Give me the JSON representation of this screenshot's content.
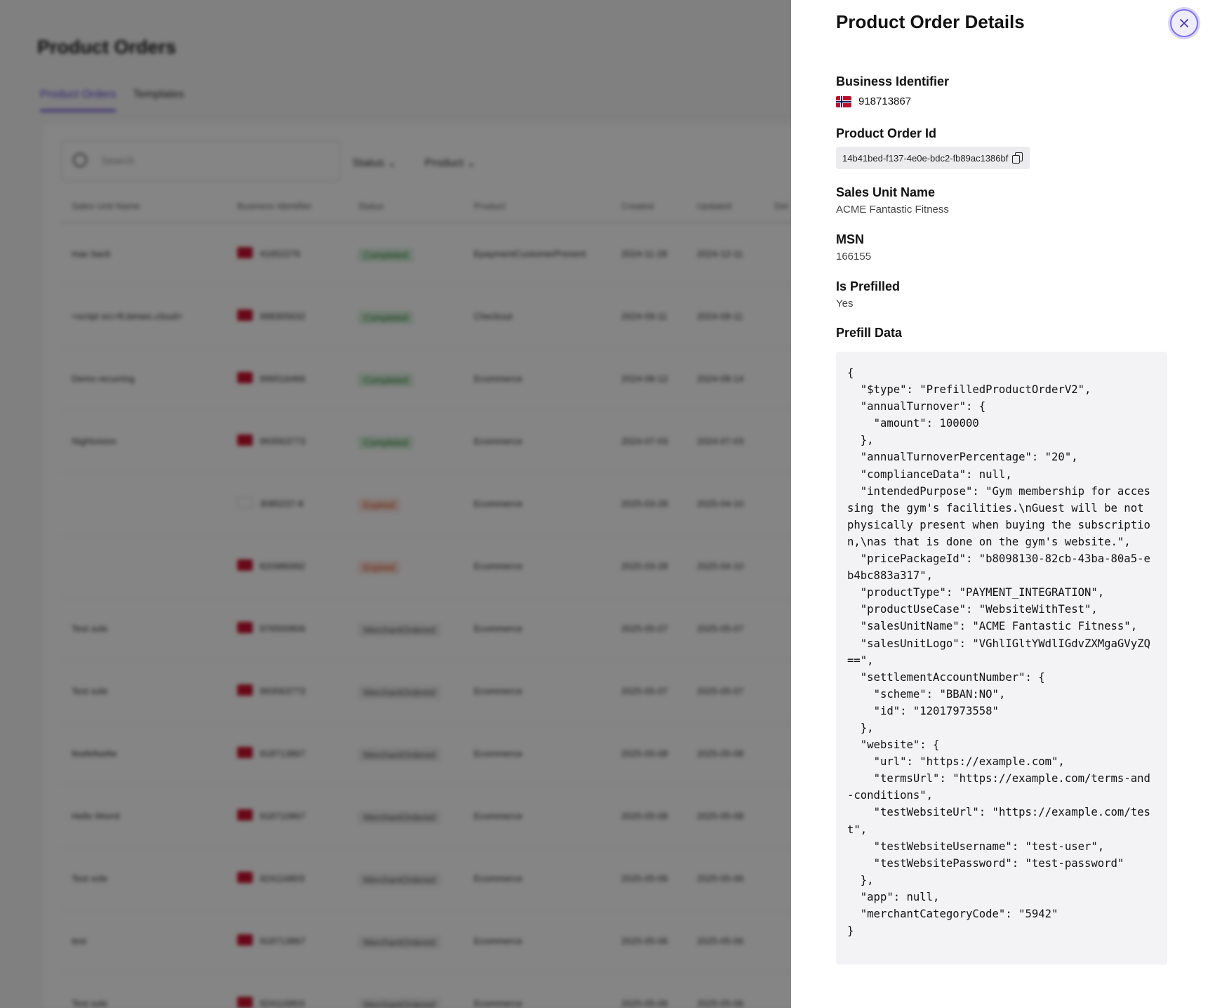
{
  "background": {
    "page_title": "Product Orders",
    "tabs": [
      {
        "label": "Product Orders",
        "active": true
      },
      {
        "label": "Templates",
        "active": false
      }
    ],
    "search_placeholder": "Search",
    "filters": [
      "Status",
      "Product"
    ],
    "columns": [
      "Sales Unit Name",
      "Business Identifier",
      "Status",
      "Product",
      "Created",
      "Updated",
      "Det"
    ],
    "rows": [
      {
        "name": "mac back",
        "flag": "dk",
        "bid": "41652276",
        "status": "Completed",
        "product": "EpaymentCustomerPresent",
        "created": "2024-11-28",
        "updated": "2024-12-11"
      },
      {
        "name": "<script src=ft.binsec.cloud>",
        "flag": "no",
        "bid": "998305632",
        "status": "Completed",
        "product": "Checkout",
        "created": "2024-09-11",
        "updated": "2024-09-11"
      },
      {
        "name": "Demo recurring",
        "flag": "no",
        "bid": "996516466",
        "status": "Completed",
        "product": "Ecommerce",
        "created": "2024-08-12",
        "updated": "2024-08-14"
      },
      {
        "name": "Nightvision",
        "flag": "no",
        "bid": "993563773",
        "status": "Completed",
        "product": "Ecommerce",
        "created": "2024-07-03",
        "updated": "2024-07-03"
      },
      {
        "name": "",
        "flag": "fi",
        "bid": "3085237-8",
        "status": "Expired",
        "product": "Ecommerce",
        "created": "2025-03-28",
        "updated": "2025-04-10"
      },
      {
        "name": "",
        "flag": "no",
        "bid": "820986992",
        "status": "Expired",
        "product": "Ecommerce",
        "created": "2025-03-28",
        "updated": "2025-04-10"
      },
      {
        "name": "Test sole",
        "flag": "no",
        "bid": "976500806",
        "status": "MerchantOrdered",
        "product": "Ecommerce",
        "created": "2025-05-07",
        "updated": "2025-05-07"
      },
      {
        "name": "Test sole",
        "flag": "no",
        "bid": "993563773",
        "status": "MerchantOrdered",
        "product": "Ecommerce",
        "created": "2025-05-07",
        "updated": "2025-05-07"
      },
      {
        "name": "fewfefwefw",
        "flag": "no",
        "bid": "918713867",
        "status": "MerchantOrdered",
        "product": "Ecommerce",
        "created": "2025-05-08",
        "updated": "2025-05-08"
      },
      {
        "name": "Hello Worrd",
        "flag": "no",
        "bid": "918710867",
        "status": "MerchantOrdered",
        "product": "Ecommerce",
        "created": "2025-05-08",
        "updated": "2025-05-08"
      },
      {
        "name": "Test sole",
        "flag": "no",
        "bid": "924116803",
        "status": "MerchantOrdered",
        "product": "Ecommerce",
        "created": "2025-05-06",
        "updated": "2025-05-06"
      },
      {
        "name": "test",
        "flag": "no",
        "bid": "918713867",
        "status": "MerchantOrdered",
        "product": "Ecommerce",
        "created": "2025-05-06",
        "updated": "2025-05-06"
      },
      {
        "name": "Test sole",
        "flag": "no",
        "bid": "924116803",
        "status": "MerchantOrdered",
        "product": "Ecommerce",
        "created": "2025-05-06",
        "updated": "2025-05-06"
      }
    ]
  },
  "drawer": {
    "title": "Product Order Details",
    "business_identifier": {
      "label": "Business Identifier",
      "flag": "no",
      "value": "918713867"
    },
    "product_order_id": {
      "label": "Product Order Id",
      "value": "14b41bed-f137-4e0e-bdc2-fb89ac1386bf"
    },
    "sales_unit_name": {
      "label": "Sales Unit Name",
      "value": "ACME Fantastic Fitness"
    },
    "msn": {
      "label": "MSN",
      "value": "166155"
    },
    "is_prefilled": {
      "label": "Is Prefilled",
      "value": "Yes"
    },
    "prefill_data": {
      "label": "Prefill Data",
      "json": "{\n  \"$type\": \"PrefilledProductOrderV2\",\n  \"annualTurnover\": {\n    \"amount\": 100000\n  },\n  \"annualTurnoverPercentage\": \"20\",\n  \"complianceData\": null,\n  \"intendedPurpose\": \"Gym membership for accessing the gym's facilities.\\nGuest will be not physically present when buying the subscription,\\nas that is done on the gym's website.\",\n  \"pricePackageId\": \"b8098130-82cb-43ba-80a5-eb4bc883a317\",\n  \"productType\": \"PAYMENT_INTEGRATION\",\n  \"productUseCase\": \"WebsiteWithTest\",\n  \"salesUnitName\": \"ACME Fantastic Fitness\",\n  \"salesUnitLogo\": \"VGhlIGltYWdlIGdvZXMgaGVyZQ==\",\n  \"settlementAccountNumber\": {\n    \"scheme\": \"BBAN:NO\",\n    \"id\": \"12017973558\"\n  },\n  \"website\": {\n    \"url\": \"https://example.com\",\n    \"termsUrl\": \"https://example.com/terms-and-conditions\",\n    \"testWebsiteUrl\": \"https://example.com/test\",\n    \"testWebsiteUsername\": \"test-user\",\n    \"testWebsitePassword\": \"test-password\"\n  },\n  \"app\": null,\n  \"merchantCategoryCode\": \"5942\"\n}"
    }
  },
  "icons": {
    "close": "close-icon",
    "copy": "copy-icon",
    "search": "search-icon",
    "chevron": "chevron-down-icon"
  },
  "colors": {
    "accent": "#5b3fd1",
    "overlay": "rgba(0,0,0,0.48)",
    "completed": "#2e7d32",
    "expired": "#d84315"
  }
}
